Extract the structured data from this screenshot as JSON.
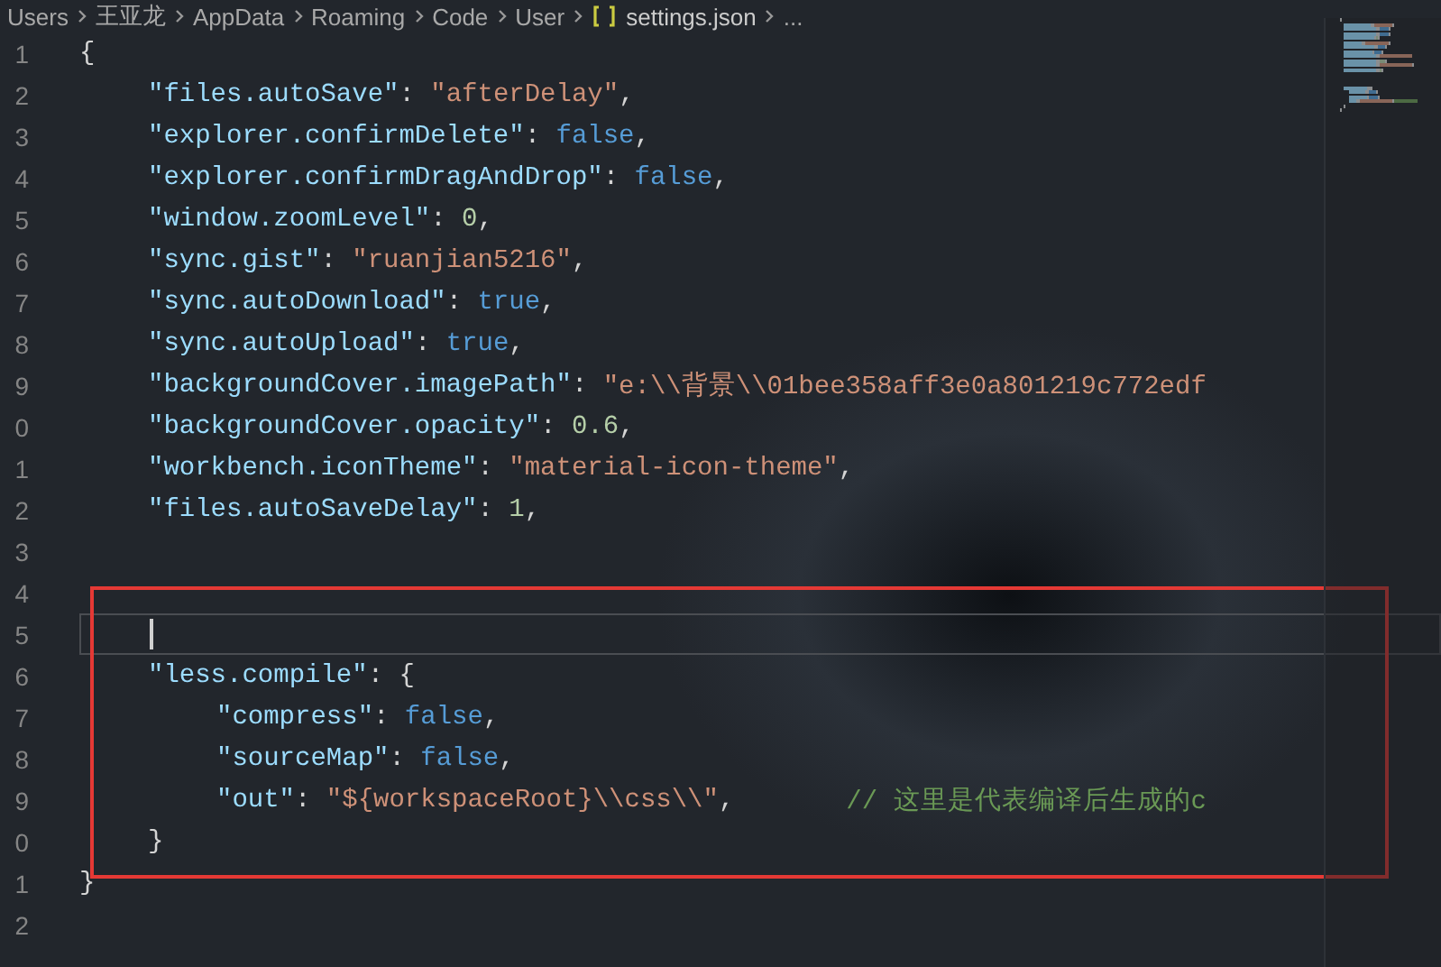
{
  "breadcrumb": [
    {
      "label": "Users",
      "kind": "folder"
    },
    {
      "label": "王亚龙",
      "kind": "folder"
    },
    {
      "label": "AppData",
      "kind": "folder"
    },
    {
      "label": "Roaming",
      "kind": "folder"
    },
    {
      "label": "Code",
      "kind": "folder"
    },
    {
      "label": "User",
      "kind": "folder"
    },
    {
      "label": "settings.json",
      "kind": "file"
    },
    {
      "label": "...",
      "kind": "more"
    }
  ],
  "lines": [
    {
      "number": "1",
      "kind": "outer",
      "current": false,
      "tokens": [
        {
          "kind": "punct",
          "text": "{"
        }
      ]
    },
    {
      "number": "2",
      "kind": "inner",
      "current": false,
      "tokens": [
        {
          "kind": "key",
          "text": "\"files.autoSave\""
        },
        {
          "kind": "punct",
          "text": ": "
        },
        {
          "kind": "string",
          "text": "\"afterDelay\""
        },
        {
          "kind": "punct",
          "text": ","
        }
      ]
    },
    {
      "number": "3",
      "kind": "inner",
      "current": false,
      "tokens": [
        {
          "kind": "key",
          "text": "\"explorer.confirmDelete\""
        },
        {
          "kind": "punct",
          "text": ": "
        },
        {
          "kind": "bool",
          "text": "false"
        },
        {
          "kind": "punct",
          "text": ","
        }
      ]
    },
    {
      "number": "4",
      "kind": "inner",
      "current": false,
      "tokens": [
        {
          "kind": "key",
          "text": "\"explorer.confirmDragAndDrop\""
        },
        {
          "kind": "punct",
          "text": ": "
        },
        {
          "kind": "bool",
          "text": "false"
        },
        {
          "kind": "punct",
          "text": ","
        }
      ]
    },
    {
      "number": "5",
      "kind": "inner",
      "current": false,
      "tokens": [
        {
          "kind": "key",
          "text": "\"window.zoomLevel\""
        },
        {
          "kind": "punct",
          "text": ": "
        },
        {
          "kind": "number",
          "text": "0"
        },
        {
          "kind": "punct",
          "text": ","
        }
      ]
    },
    {
      "number": "6",
      "kind": "inner",
      "current": false,
      "tokens": [
        {
          "kind": "key",
          "text": "\"sync.gist\""
        },
        {
          "kind": "punct",
          "text": ": "
        },
        {
          "kind": "string",
          "text": "\"ruanjian5216\""
        },
        {
          "kind": "punct",
          "text": ","
        }
      ]
    },
    {
      "number": "7",
      "kind": "inner",
      "current": false,
      "tokens": [
        {
          "kind": "key",
          "text": "\"sync.autoDownload\""
        },
        {
          "kind": "punct",
          "text": ": "
        },
        {
          "kind": "bool",
          "text": "true"
        },
        {
          "kind": "punct",
          "text": ","
        }
      ]
    },
    {
      "number": "8",
      "kind": "inner",
      "current": false,
      "tokens": [
        {
          "kind": "key",
          "text": "\"sync.autoUpload\""
        },
        {
          "kind": "punct",
          "text": ": "
        },
        {
          "kind": "bool",
          "text": "true"
        },
        {
          "kind": "punct",
          "text": ","
        }
      ]
    },
    {
      "number": "9",
      "kind": "inner",
      "current": false,
      "tokens": [
        {
          "kind": "key",
          "text": "\"backgroundCover.imagePath\""
        },
        {
          "kind": "punct",
          "text": ": "
        },
        {
          "kind": "string",
          "text": "\"e:\\\\背景\\\\01bee358aff3e0a801219c772edf"
        }
      ]
    },
    {
      "number": "0",
      "kind": "inner",
      "current": false,
      "tokens": [
        {
          "kind": "key",
          "text": "\"backgroundCover.opacity\""
        },
        {
          "kind": "punct",
          "text": ": "
        },
        {
          "kind": "number",
          "text": "0.6"
        },
        {
          "kind": "punct",
          "text": ","
        }
      ]
    },
    {
      "number": "1",
      "kind": "inner",
      "current": false,
      "tokens": [
        {
          "kind": "key",
          "text": "\"workbench.iconTheme\""
        },
        {
          "kind": "punct",
          "text": ": "
        },
        {
          "kind": "string",
          "text": "\"material-icon-theme\""
        },
        {
          "kind": "punct",
          "text": ","
        }
      ]
    },
    {
      "number": "2",
      "kind": "inner",
      "current": false,
      "tokens": [
        {
          "kind": "key",
          "text": "\"files.autoSaveDelay\""
        },
        {
          "kind": "punct",
          "text": ": "
        },
        {
          "kind": "number",
          "text": "1"
        },
        {
          "kind": "punct",
          "text": ","
        }
      ]
    },
    {
      "number": "3",
      "kind": "inner",
      "current": false
    },
    {
      "number": "4",
      "kind": "inner",
      "current": false
    },
    {
      "number": "5",
      "kind": "inner",
      "current": true
    },
    {
      "number": "6",
      "kind": "inner",
      "current": false,
      "tokens": [
        {
          "kind": "key",
          "text": "\"less.compile\""
        },
        {
          "kind": "punct",
          "text": ": {"
        }
      ]
    },
    {
      "number": "7",
      "kind": "nested",
      "current": false,
      "tokens": [
        {
          "kind": "key",
          "text": "\"compress\""
        },
        {
          "kind": "punct",
          "text": ": "
        },
        {
          "kind": "bool",
          "text": "false"
        },
        {
          "kind": "punct",
          "text": ","
        }
      ]
    },
    {
      "number": "8",
      "kind": "nested",
      "current": false,
      "tokens": [
        {
          "kind": "key",
          "text": "\"sourceMap\""
        },
        {
          "kind": "punct",
          "text": ": "
        },
        {
          "kind": "bool",
          "text": "false"
        },
        {
          "kind": "punct",
          "text": ","
        }
      ]
    },
    {
      "number": "9",
      "kind": "nested",
      "current": false,
      "tokens": [
        {
          "kind": "key",
          "text": "\"out\""
        },
        {
          "kind": "punct",
          "text": ": "
        },
        {
          "kind": "string",
          "text": "\"${workspaceRoot}\\\\css\\\\\""
        },
        {
          "kind": "punct",
          "text": ","
        },
        {
          "kind": "comment",
          "text": "// 这里是代表编译后生成的c"
        }
      ]
    },
    {
      "number": "0",
      "kind": "inner",
      "current": false,
      "tokens": [
        {
          "kind": "punct",
          "text": "}"
        }
      ]
    },
    {
      "number": "1",
      "kind": "outer",
      "current": false,
      "tokens": [
        {
          "kind": "punct",
          "text": "}"
        }
      ]
    },
    {
      "number": "2",
      "kind": "outer",
      "current": false
    }
  ]
}
